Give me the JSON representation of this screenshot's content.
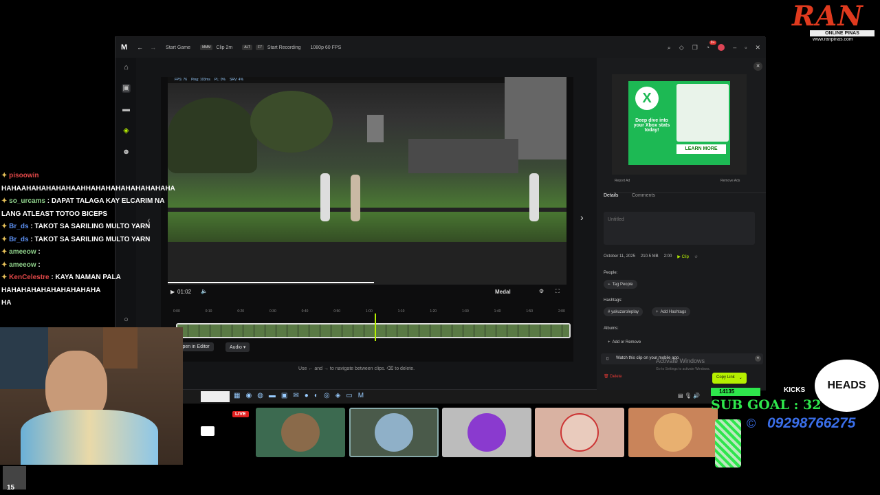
{
  "watermark": {
    "text": "RAN",
    "subtitle": "ONLINE PINAS",
    "url": "www.ranpinas.com"
  },
  "window": {
    "title_items": [
      {
        "kbd": "",
        "label": "Start Game"
      },
      {
        "kbd": "MMM",
        "label": "Clip 2m"
      },
      {
        "kbd": "ALT",
        "label": "Start Recording"
      },
      {
        "kbd": "",
        "label": "1080p 60 FPS"
      }
    ],
    "notif_badge": "9+"
  },
  "player": {
    "hud": [
      "FPS: 76",
      "Ping: 103ms",
      "PL: 0%",
      "SRV: 4%"
    ],
    "time": "01:02",
    "brand": "Medal",
    "timeline_ticks": [
      "0:00",
      "0:10",
      "0:20",
      "0:30",
      "0:40",
      "0:50",
      "1:00",
      "1:10",
      "1:20",
      "1:30",
      "1:40",
      "1:50",
      "2:00"
    ],
    "open_editor": "Open in Editor",
    "audio": "Audio",
    "hint": "Use ← and → to navigate between clips.  ⌫ to delete."
  },
  "ad": {
    "text": "Deep dive into your Xbox stats today!",
    "cta": "LEARN MORE",
    "report": "Report Ad",
    "remove": "Remove Ads"
  },
  "details": {
    "tabs": [
      "Details",
      "Comments"
    ],
    "title_placeholder": "Untitled",
    "date": "October 11, 2025",
    "size": "210.5 MB",
    "duration": "2:00",
    "type": "Clip",
    "people_label": "People:",
    "tag_people": "Tag People",
    "hashtags_label": "Hashtags:",
    "hashtag": "# yakuzaroleplay",
    "add_hashtags": "Add Hashtags",
    "albums_label": "Albums:",
    "add_remove": "Add or Remove",
    "mobile_notice": "Watch this clip on your mobile app",
    "activate": "Activate Windows",
    "activate_sub": "Go to Settings to activate Windows.",
    "delete": "Delete",
    "copy_link": "Copy Link"
  },
  "chat": [
    {
      "user": "pisoowin",
      "msg": ""
    },
    {
      "user": "",
      "msg": "HAHAAHAHAHAHAHAAHHAHAHAHAHAHAHAHAHA"
    },
    {
      "user": "so_urcams",
      "msg": ": DAPAT TALAGA KAY ELCARIM NA"
    },
    {
      "user": "",
      "msg": "LANG ATLEAST TOTOO BICEPS"
    },
    {
      "user": "Br_ds",
      "msg": ": TAKOT SA SARILING MULTO YARN"
    },
    {
      "user": "Br_ds",
      "msg": ": TAKOT SA SARILING MULTO YARN"
    },
    {
      "user": "ameeow",
      "msg": ":"
    },
    {
      "user": "ameeow",
      "msg": ":"
    },
    {
      "user": "KenCelestre",
      "msg": ": KAYA NAMAN PALA"
    },
    {
      "user": "",
      "msg": "HAHAHAHAHAHAHAHAHAHA"
    },
    {
      "user": "",
      "msg": "HA"
    }
  ],
  "stream": {
    "live": "LIVE",
    "kicks": "KICKS",
    "kicks_count": "14135",
    "heads": "HEADS",
    "sub_goal": "SUB GOAL : 32",
    "phone": "09298766275",
    "viewer_count": "15"
  },
  "colors": {
    "accent": "#b6f000",
    "danger": "#e53935",
    "live": "#e02020",
    "goal": "#2ee64c"
  }
}
